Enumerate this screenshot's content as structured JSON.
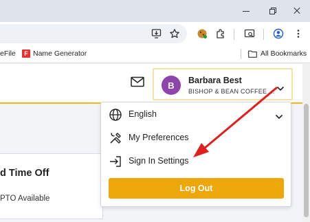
{
  "browser": {
    "bookmarks": {
      "items": [
        {
          "label": "eFile",
          "icon": "favicon"
        },
        {
          "label": "Name Generator",
          "icon": "f-logo-icon",
          "logo_letter": "F"
        }
      ],
      "all_bookmarks_label": "All Bookmarks"
    }
  },
  "header": {
    "profile": {
      "avatar_initial": "B",
      "avatar_color": "#8e44ad",
      "name": "Barbara Best",
      "company": "BISHOP & BEAN COFFEE ..."
    }
  },
  "dropdown": {
    "items": [
      {
        "label": "English",
        "icon": "globe-icon"
      },
      {
        "label": "My Preferences",
        "icon": "tools-icon"
      },
      {
        "label": "Sign In Settings",
        "icon": "sign-in-icon"
      }
    ],
    "logout_label": "Log Out",
    "logout_color": "#eea70a"
  },
  "card": {
    "title": "d Time Off",
    "subtitle": "PTO Available"
  },
  "colors": {
    "accent": "#f1b91e",
    "annotation_arrow": "#e0201c"
  }
}
